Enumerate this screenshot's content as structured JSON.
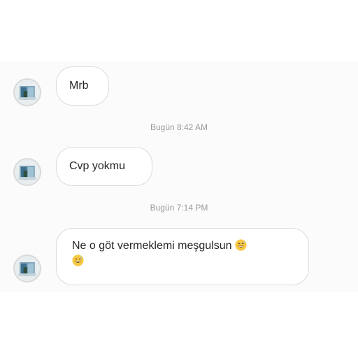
{
  "messages": [
    {
      "text": "Mrb"
    },
    {
      "text": "Cvp yokmu"
    },
    {
      "text": "Ne o göt vermeklemi meşgulsun",
      "emoji_icon": "grinning-sweat-emoji-icon"
    }
  ],
  "timestamps": [
    "Bugün 8:42 AM",
    "Bugün 7:14 PM"
  ],
  "colors": {
    "bubble_border": "#dcdcdc",
    "bubble_bg": "#ffffff",
    "text": "#262626",
    "timestamp": "#9a9a9a",
    "emoji": "#f7c843"
  }
}
